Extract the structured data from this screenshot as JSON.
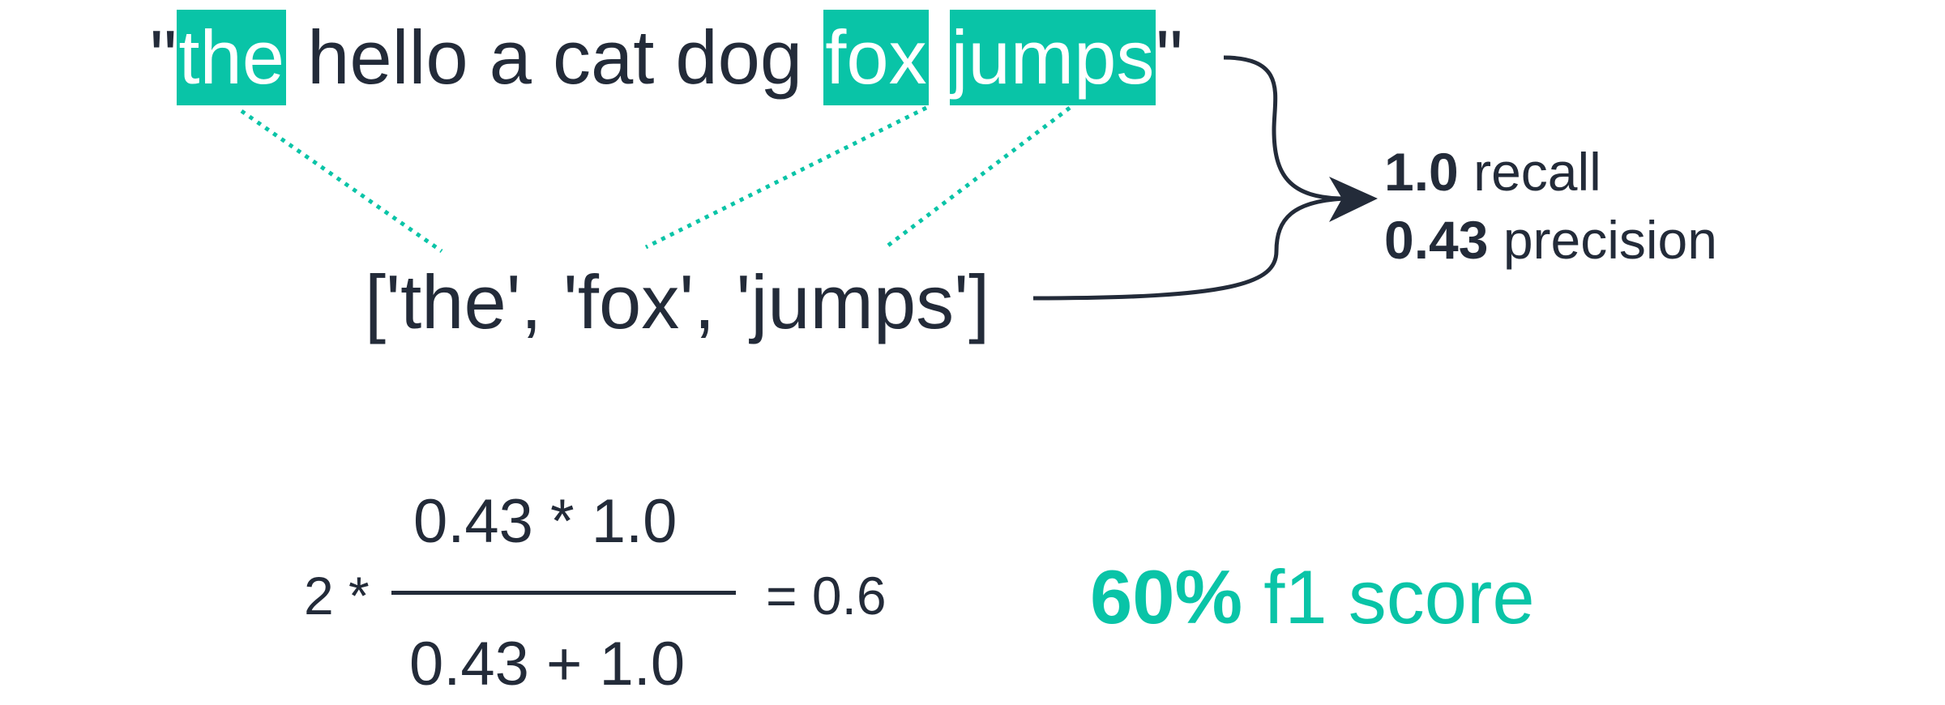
{
  "sentence": {
    "open_quote": "\"",
    "tokens": [
      {
        "text": "the",
        "highlighted": true
      },
      {
        "text": "hello",
        "highlighted": false
      },
      {
        "text": "a",
        "highlighted": false
      },
      {
        "text": "cat",
        "highlighted": false
      },
      {
        "text": "dog",
        "highlighted": false
      },
      {
        "text": "fox",
        "highlighted": true
      },
      {
        "text": "jumps",
        "highlighted": true
      }
    ],
    "close_quote": "\""
  },
  "prediction": "['the', 'fox', 'jumps']",
  "metrics": {
    "recall_value": "1.0",
    "recall_label": "recall",
    "precision_value": "0.43",
    "precision_label": "precision"
  },
  "formula": {
    "factor": "2 *",
    "numerator": "0.43 * 1.0",
    "denominator": "0.43 + 1.0",
    "result": "= 0.6"
  },
  "f1": {
    "value": "60%",
    "label": "f1 score"
  },
  "colors": {
    "accent": "#09c4a7",
    "text": "#232b39"
  }
}
